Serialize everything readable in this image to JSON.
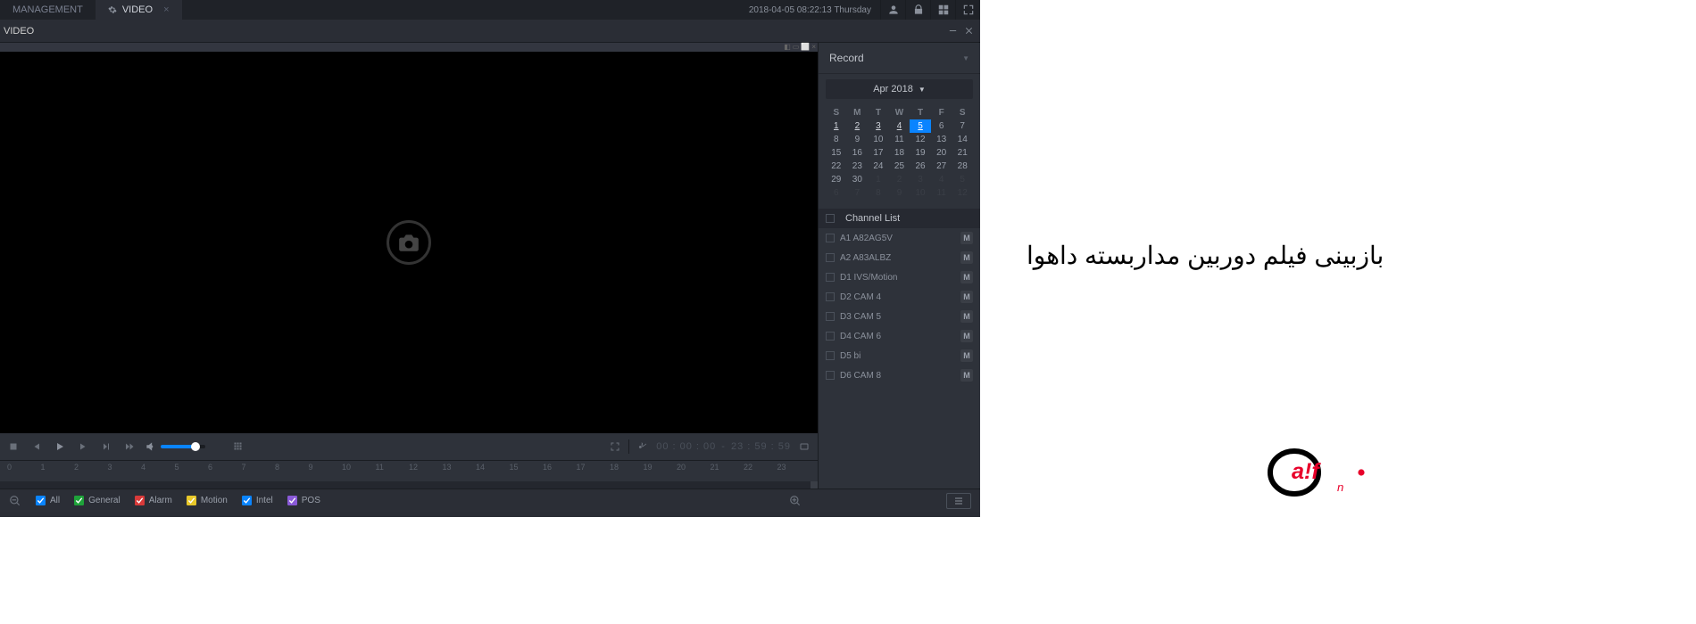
{
  "tabs": {
    "management": "MANAGEMENT",
    "video": "VIDEO"
  },
  "datetime": "2018-04-05 08:22:13 Thursday",
  "subheader": {
    "title": "VIDEO"
  },
  "sidebar": {
    "record_title": "Record",
    "month": "Apr 2018",
    "dow": [
      "S",
      "M",
      "T",
      "W",
      "T",
      "F",
      "S"
    ],
    "weeks": [
      [
        {
          "d": "1",
          "r": 1
        },
        {
          "d": "2",
          "r": 1
        },
        {
          "d": "3",
          "r": 1
        },
        {
          "d": "4",
          "r": 1
        },
        {
          "d": "5",
          "r": 1,
          "sel": 1
        },
        {
          "d": "6"
        },
        {
          "d": "7"
        }
      ],
      [
        {
          "d": "8"
        },
        {
          "d": "9"
        },
        {
          "d": "10"
        },
        {
          "d": "11"
        },
        {
          "d": "12"
        },
        {
          "d": "13"
        },
        {
          "d": "14"
        }
      ],
      [
        {
          "d": "15"
        },
        {
          "d": "16"
        },
        {
          "d": "17"
        },
        {
          "d": "18"
        },
        {
          "d": "19"
        },
        {
          "d": "20"
        },
        {
          "d": "21"
        }
      ],
      [
        {
          "d": "22"
        },
        {
          "d": "23"
        },
        {
          "d": "24"
        },
        {
          "d": "25"
        },
        {
          "d": "26"
        },
        {
          "d": "27"
        },
        {
          "d": "28"
        }
      ],
      [
        {
          "d": "29"
        },
        {
          "d": "30"
        },
        {
          "d": "1",
          "dim": 1
        },
        {
          "d": "2",
          "dim": 1
        },
        {
          "d": "3",
          "dim": 1
        },
        {
          "d": "4",
          "dim": 1
        },
        {
          "d": "5",
          "dim": 1
        }
      ],
      [
        {
          "d": "6",
          "dim": 1
        },
        {
          "d": "7",
          "dim": 1
        },
        {
          "d": "8",
          "dim": 1
        },
        {
          "d": "9",
          "dim": 1
        },
        {
          "d": "10",
          "dim": 1
        },
        {
          "d": "11",
          "dim": 1
        },
        {
          "d": "12",
          "dim": 1
        }
      ]
    ],
    "channel_list_label": "Channel List",
    "channels": [
      {
        "label": "A1 A82AG5V",
        "badge": "M"
      },
      {
        "label": "A2 A83ALBZ",
        "badge": "M"
      },
      {
        "label": "D1 IVS/Motion",
        "badge": "M"
      },
      {
        "label": "D2 CAM 4",
        "badge": "M"
      },
      {
        "label": "D3 CAM 5",
        "badge": "M"
      },
      {
        "label": "D4 CAM 6",
        "badge": "M"
      },
      {
        "label": "D5 bi",
        "badge": "M"
      },
      {
        "label": "D6 CAM 8",
        "badge": "M"
      }
    ]
  },
  "controls": {
    "timecode_start": "00 : 00 : 00",
    "timecode_sep": "-",
    "timecode_end": "23 : 59 : 59"
  },
  "timeline": {
    "hours": [
      "0",
      "1",
      "2",
      "3",
      "4",
      "5",
      "6",
      "7",
      "8",
      "9",
      "10",
      "11",
      "12",
      "13",
      "14",
      "15",
      "16",
      "17",
      "18",
      "19",
      "20",
      "21",
      "22",
      "23"
    ]
  },
  "legend": {
    "all": "All",
    "general": "General",
    "alarm": "Alarm",
    "motion": "Motion",
    "intel": "Intel",
    "pos": "POS",
    "colors": {
      "all": "#0a84ff",
      "general": "#1fa33a",
      "alarm": "#d83a3a",
      "motion": "#e8c82a",
      "intel": "#0a84ff",
      "pos": "#8a5ad8"
    }
  },
  "persian_text": "بازبینی فیلم دوربین مداربسته داهوا"
}
